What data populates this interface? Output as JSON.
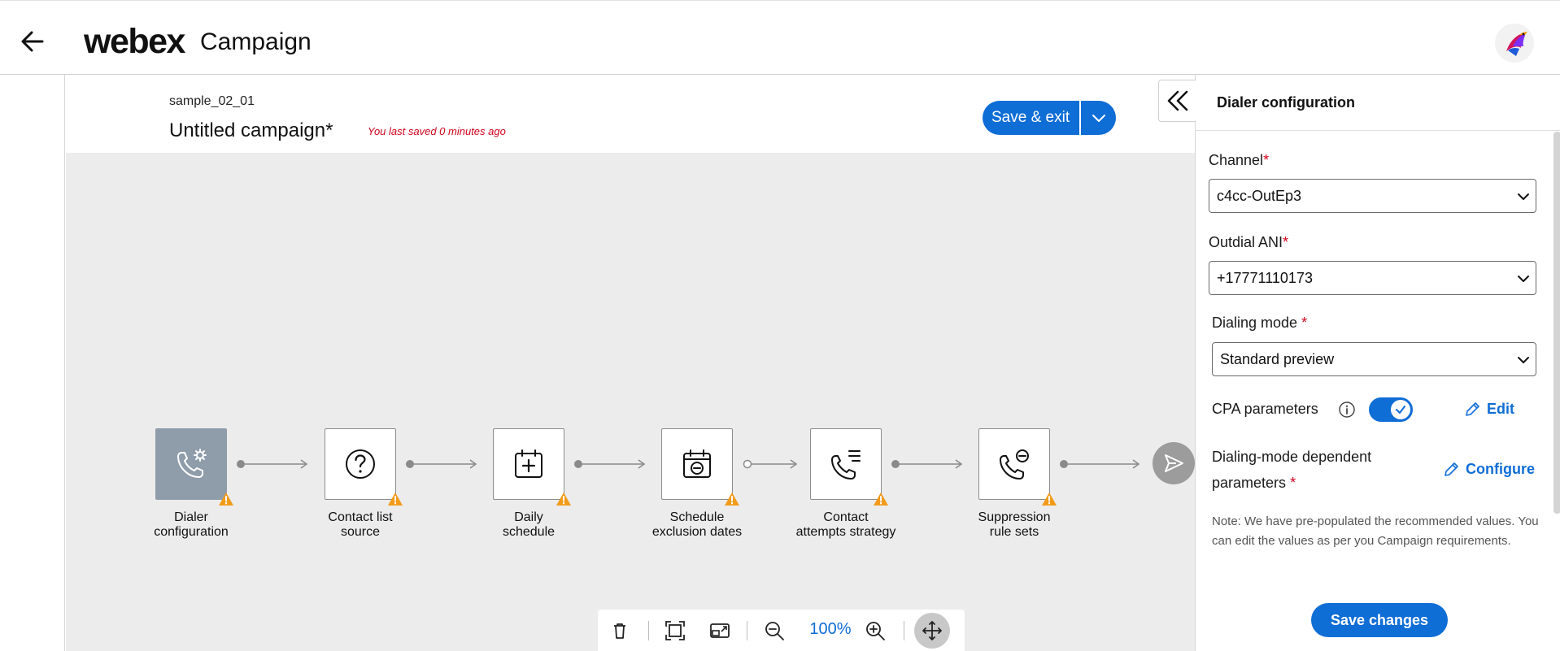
{
  "header": {
    "brand": "webex",
    "app_name": "Campaign",
    "back_icon": "arrow-left-icon",
    "avatar_icon": "bird-logo-icon"
  },
  "campaign": {
    "id_label": "sample_02_01",
    "title": "Untitled campaign*",
    "saved_note": "You last saved 0 minutes ago",
    "save_exit_label": "Save & exit"
  },
  "flow": {
    "nodes": [
      {
        "label_line1": "Dialer",
        "label_line2": "configuration",
        "icon": "phone-gear-icon",
        "active": true
      },
      {
        "label_line1": "Contact list",
        "label_line2": "source",
        "icon": "question-circle-icon",
        "active": false
      },
      {
        "label_line1": "Daily",
        "label_line2": "schedule",
        "icon": "calendar-add-icon",
        "active": false
      },
      {
        "label_line1": "Schedule",
        "label_line2": "exclusion dates",
        "icon": "calendar-minus-icon",
        "active": false
      },
      {
        "label_line1": "Contact",
        "label_line2": "attempts strategy",
        "icon": "phone-list-icon",
        "active": false
      },
      {
        "label_line1": "Suppression",
        "label_line2": "rule sets",
        "icon": "phone-block-icon",
        "active": false
      }
    ],
    "warning_icon": "warning-triangle-icon",
    "send_icon": "send-icon"
  },
  "toolbar": {
    "zoom_level": "100%",
    "icons": [
      "delete-icon",
      "fit-screen-icon",
      "minimap-icon",
      "zoom-out-icon",
      "zoom-in-icon",
      "pan-move-icon"
    ]
  },
  "panel": {
    "title": "Dialer configuration",
    "channel_label": "Channel",
    "channel_value": "c4cc-OutEp3",
    "ani_label": "Outdial ANI",
    "ani_value": "+17771110173",
    "dialing_mode_label": "Dialing mode",
    "dialing_mode_value": "Standard preview",
    "cpa_label": "CPA parameters",
    "cpa_enabled": true,
    "edit_label": "Edit",
    "dep_label_line1": "Dialing-mode dependent",
    "dep_label_line2": "parameters",
    "configure_label": "Configure",
    "note": "Note: We have pre-populated the recommended values. You can edit the values as per you Campaign requirements.",
    "save_changes_label": "Save changes",
    "required_mark": "*"
  },
  "colors": {
    "accent": "#0f6dd6",
    "warning": "#f29b1a",
    "required": "#d0021b",
    "canvas_bg": "#ececec"
  }
}
